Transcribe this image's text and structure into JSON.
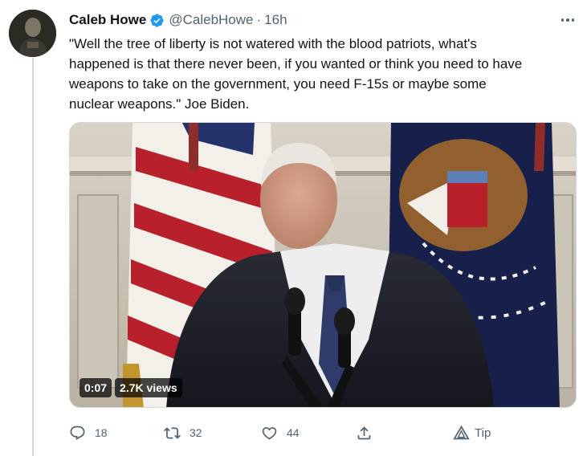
{
  "tweet": {
    "display_name": "Caleb Howe",
    "verified": true,
    "handle": "@CalebHowe",
    "separator": "·",
    "time": "16h",
    "text": "\"Well the tree of liberty is not watered with the blood patriots, what's\nhappened is that there never been, if you wanted or think you need to have\nweapons to take on the government, you need F-15s or maybe some\nnuclear weapons.\" Joe Biden.",
    "media": {
      "type": "video",
      "duration": "0:07",
      "views": "2.7K views"
    },
    "actions": {
      "reply_count": "18",
      "retweet_count": "32",
      "like_count": "44",
      "tip_label": "Tip"
    }
  },
  "icons": {
    "avatar": "avatar",
    "verified": "verified-badge-icon",
    "more": "more-dots-icon",
    "reply": "reply-icon",
    "retweet": "retweet-icon",
    "like": "heart-icon",
    "share": "share-icon",
    "tip": "tip-icon"
  },
  "colors": {
    "verified_blue": "#1d9bf0",
    "secondary_text": "#536471",
    "thread_line": "#cfd9de"
  }
}
